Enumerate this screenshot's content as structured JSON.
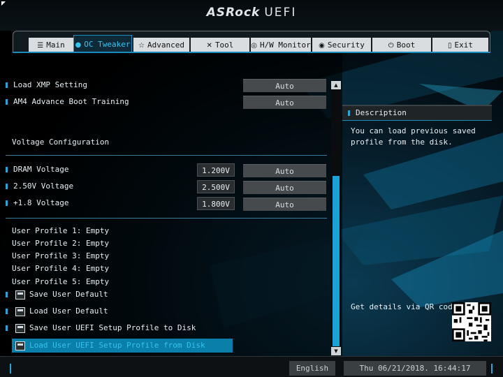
{
  "header": {
    "brand": "ASRock",
    "product": "UEFI"
  },
  "tabs": [
    {
      "label": "Main",
      "icon": "list-icon",
      "glyph": "☰"
    },
    {
      "label": "OC Tweaker",
      "icon": "flame-icon",
      "glyph": "●"
    },
    {
      "label": "Advanced",
      "icon": "star-icon",
      "glyph": "☆"
    },
    {
      "label": "Tool",
      "icon": "tools-icon",
      "glyph": "✕"
    },
    {
      "label": "H/W Monitor",
      "icon": "monitor-icon",
      "glyph": "◎"
    },
    {
      "label": "Security",
      "icon": "shield-icon",
      "glyph": "◉"
    },
    {
      "label": "Boot",
      "icon": "power-icon",
      "glyph": "⏻"
    },
    {
      "label": "Exit",
      "icon": "exit-icon",
      "glyph": "▯"
    }
  ],
  "active_tab": "OC Tweaker",
  "settings": {
    "load_xmp": {
      "label": "Load XMP Setting",
      "value": "Auto"
    },
    "am4_boot": {
      "label": "AM4 Advance Boot Training",
      "value": "Auto"
    },
    "voltage_section": "Voltage Configuration",
    "dram": {
      "label": "DRAM Voltage",
      "reading": "1.200V",
      "value": "Auto"
    },
    "v250": {
      "label": "2.50V Voltage",
      "reading": "2.500V",
      "value": "Auto"
    },
    "v18": {
      "label": "+1.8 Voltage",
      "reading": "1.800V",
      "value": "Auto"
    }
  },
  "profiles": [
    "User Profile 1: Empty",
    "User Profile 2: Empty",
    "User Profile 3: Empty",
    "User Profile 4: Empty",
    "User Profile 5: Empty"
  ],
  "actions": [
    {
      "label": "Save User Default",
      "icon": "floppy-icon"
    },
    {
      "label": "Load User Default",
      "icon": "book-icon"
    },
    {
      "label": "Save User UEFI Setup Profile to Disk",
      "icon": "disk-save-icon"
    },
    {
      "label": "Load User UEFI Setup Profile from Disk",
      "icon": "disk-load-icon"
    }
  ],
  "selected_action": "Load User UEFI Setup Profile from Disk",
  "description": {
    "title": "Description",
    "text": "You can load previous saved profile from the disk.",
    "qr_text": "Get details via QR code"
  },
  "footer": {
    "language": "English",
    "datetime": "Thu 06/21/2018. 16:44:17"
  },
  "colors": {
    "accent": "#1aa3d8",
    "highlight": "#36c2ef",
    "tab_bg": "#d9dde0"
  }
}
